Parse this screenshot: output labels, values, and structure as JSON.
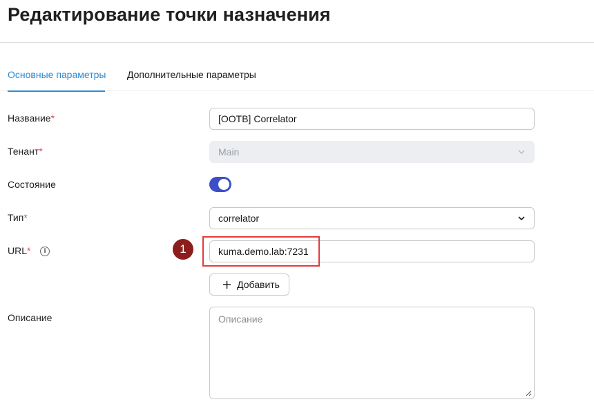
{
  "page": {
    "title": "Редактирование точки назначения"
  },
  "tabs": [
    {
      "label": "Основные параметры",
      "active": true
    },
    {
      "label": "Дополнительные параметры",
      "active": false
    }
  ],
  "form": {
    "name": {
      "label": "Название",
      "required_mark": "*",
      "value": "[OOTB] Correlator"
    },
    "tenant": {
      "label": "Тенант",
      "required_mark": "*",
      "value": "Main",
      "disabled": true,
      "icon": "chevron-down-icon"
    },
    "state": {
      "label": "Состояние",
      "enabled": true
    },
    "type": {
      "label": "Тип",
      "required_mark": "*",
      "value": "correlator",
      "icon": "chevron-down-icon"
    },
    "url": {
      "label": "URL",
      "required_mark": "*",
      "info_icon": "info-icon",
      "info_glyph": "i",
      "value": "kuma.demo.lab:7231"
    },
    "add_button": {
      "label": "Добавить",
      "icon": "plus-icon",
      "glyph": "+"
    },
    "description": {
      "label": "Описание",
      "placeholder": "Описание",
      "value": ""
    }
  },
  "annotation": {
    "marker_number": "1",
    "marker_color": "#8b1d1d",
    "highlight_color": "#e23b3b"
  },
  "colors": {
    "accent": "#2a8ad4",
    "toggle_on": "#3d4fc6",
    "required": "#e5484d"
  }
}
